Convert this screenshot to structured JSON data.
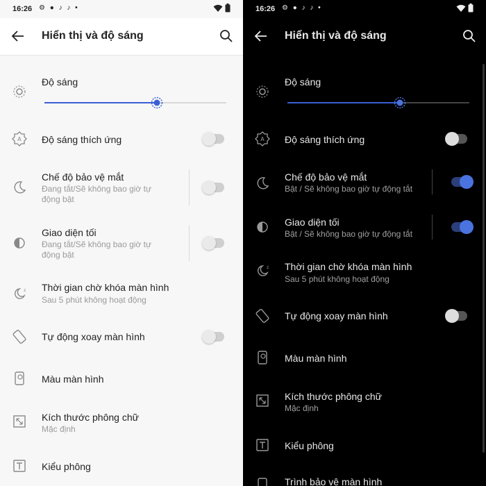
{
  "status": {
    "time": "16:26",
    "dot": "•"
  },
  "appbar": {
    "title": "Hiển thị và độ sáng"
  },
  "brightness": {
    "label": "Độ sáng",
    "level_percent": 62
  },
  "adaptive": {
    "label": "Độ sáng thích ứng"
  },
  "eye_comfort": {
    "label": "Chế độ bảo vệ mắt",
    "sub_light_1": "Đang tắt/Sẽ không bao giờ tự",
    "sub_light_2": "động bật",
    "sub_dark": "Bật / Sẽ không bao giờ tự động tắt"
  },
  "dark_mode": {
    "label": "Giao diện tối",
    "sub_light_1": "Đang tắt/Sẽ không bao giờ tự",
    "sub_light_2": "động bật",
    "sub_dark": "Bật / Sẽ không bao giờ tự động tắt"
  },
  "timeout": {
    "label": "Thời gian chờ khóa màn hình",
    "sub": "Sau 5 phút không hoạt động"
  },
  "auto_rotate": {
    "label": "Tự động xoay màn hình"
  },
  "screen_color": {
    "label": "Màu màn hình"
  },
  "font_size": {
    "label": "Kích thước phông chữ",
    "sub": "Mặc định"
  },
  "font_style": {
    "label": "Kiểu phông"
  },
  "screensaver": {
    "label": "Trình bảo vệ màn hình"
  },
  "colors": {
    "accent": "#3a5fd6",
    "dark_toggle_on": "#4a73e0"
  }
}
